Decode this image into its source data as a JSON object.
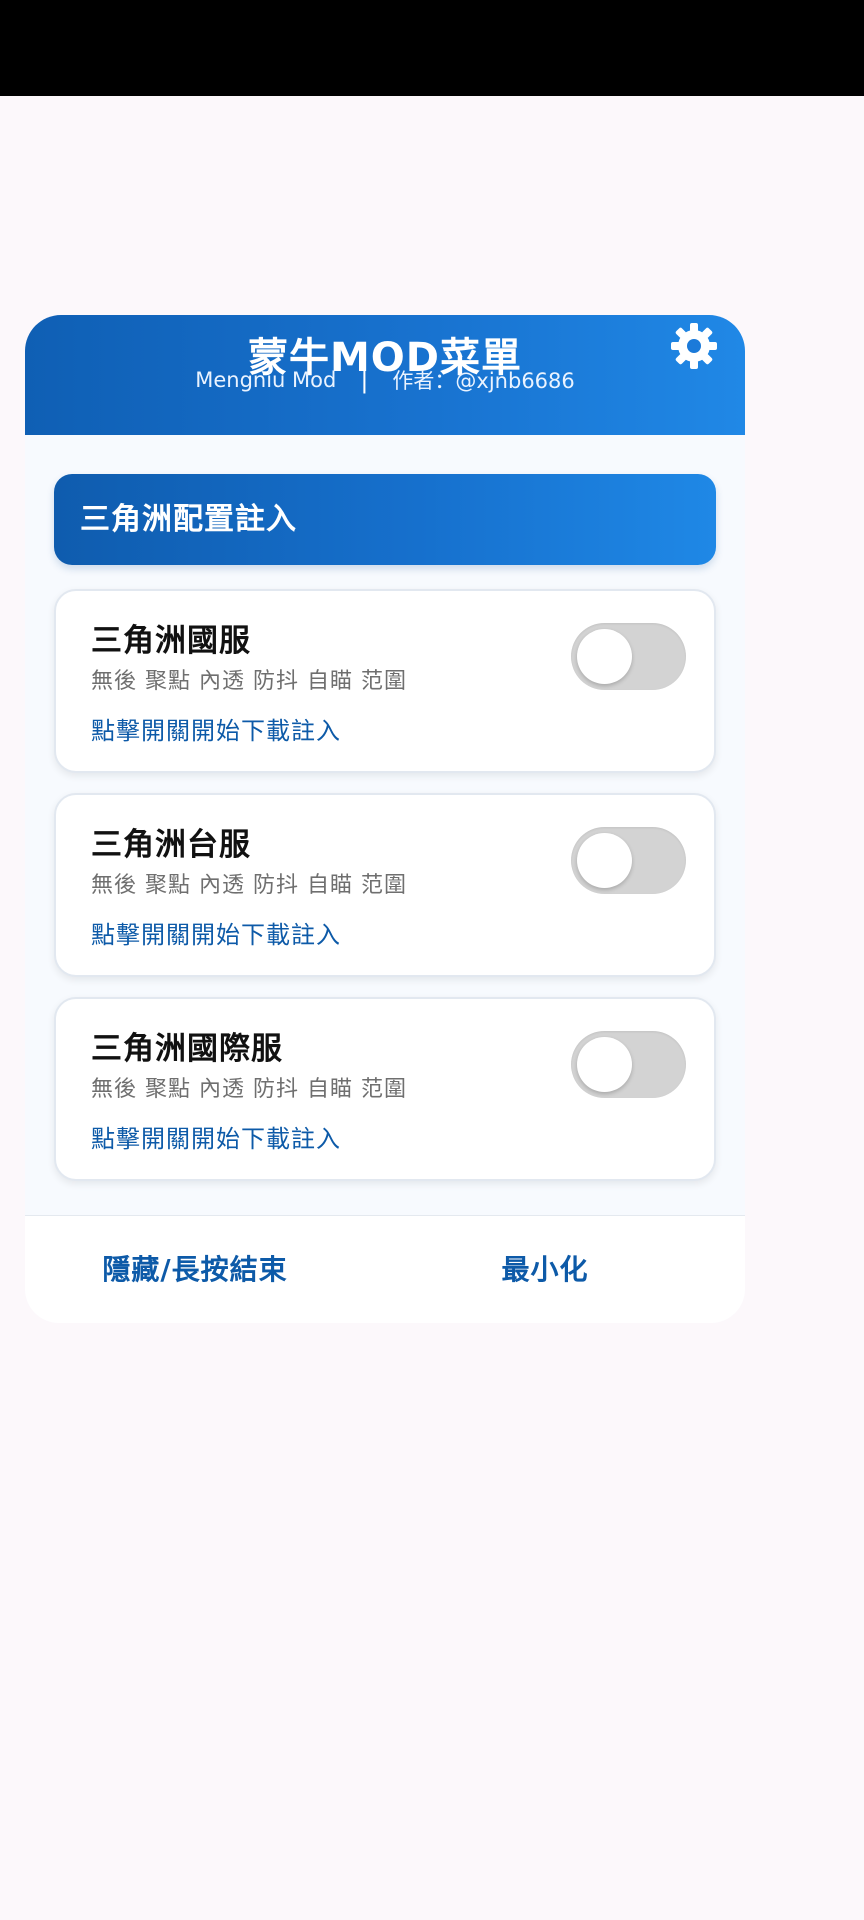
{
  "header": {
    "title": "蒙牛MOD菜單",
    "brand": "Mengniu Mod",
    "separator": "|",
    "author": "作者：@xjnb6686",
    "settings_icon": "gear-icon"
  },
  "section": {
    "title": "三角洲配置註入"
  },
  "cards": [
    {
      "title": "三角洲國服",
      "features": "無後 聚點 內透 防抖 自瞄 范圍",
      "action": "點擊開關開始下載註入",
      "enabled": false
    },
    {
      "title": "三角洲台服",
      "features": "無後 聚點 內透 防抖 自瞄 范圍",
      "action": "點擊開關開始下載註入",
      "enabled": false
    },
    {
      "title": "三角洲國際服",
      "features": "無後 聚點 內透 防抖 自瞄 范圍",
      "action": "點擊開關開始下載註入",
      "enabled": false
    }
  ],
  "footer": {
    "hide_label": "隱藏/長按結束",
    "minimize_label": "最小化"
  },
  "colors": {
    "header_blue": "#1872cf",
    "accent_blue": "#0d5aa8",
    "toggle_off": "#d3d3d3"
  }
}
